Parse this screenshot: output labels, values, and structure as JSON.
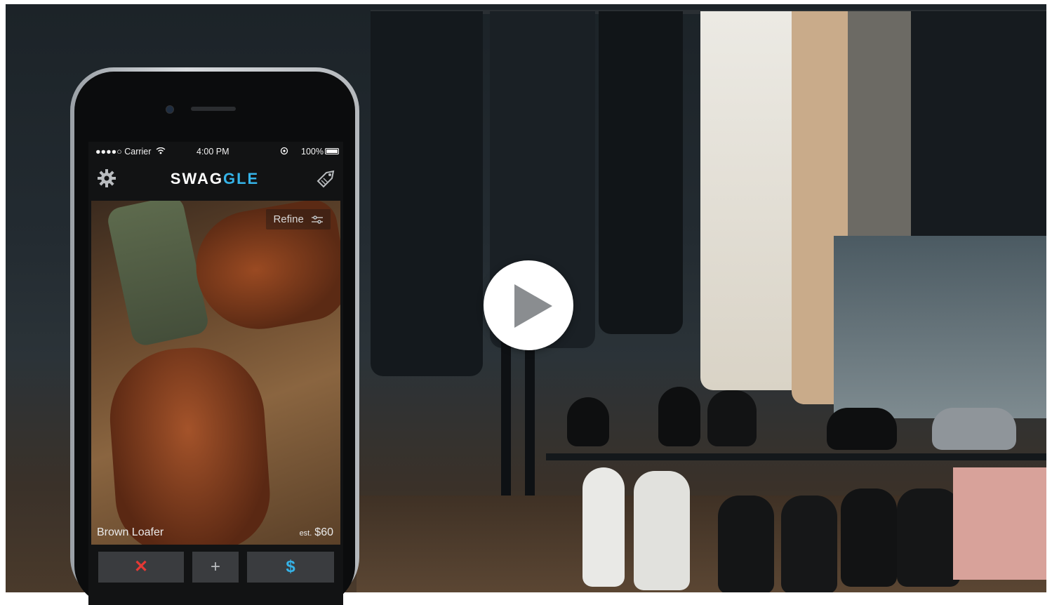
{
  "status_bar": {
    "carrier": "●●●●○ Carrier",
    "time": "4:00 PM",
    "battery": "100%"
  },
  "app": {
    "logo_main": "SWAG",
    "logo_accent": "GLE"
  },
  "product": {
    "refine_label": "Refine",
    "name": "Brown Loafer",
    "price_prefix": "est.",
    "price": "$60"
  },
  "actions": {
    "reject": "✕",
    "add": "+",
    "buy": "$"
  },
  "icons": {
    "settings": "gear-icon",
    "tag": "price-tag-icon",
    "play": "play-icon",
    "wifi": "wifi-icon",
    "refine": "sliders-icon"
  },
  "colors": {
    "accent": "#35b3e8",
    "reject": "#e53935"
  }
}
